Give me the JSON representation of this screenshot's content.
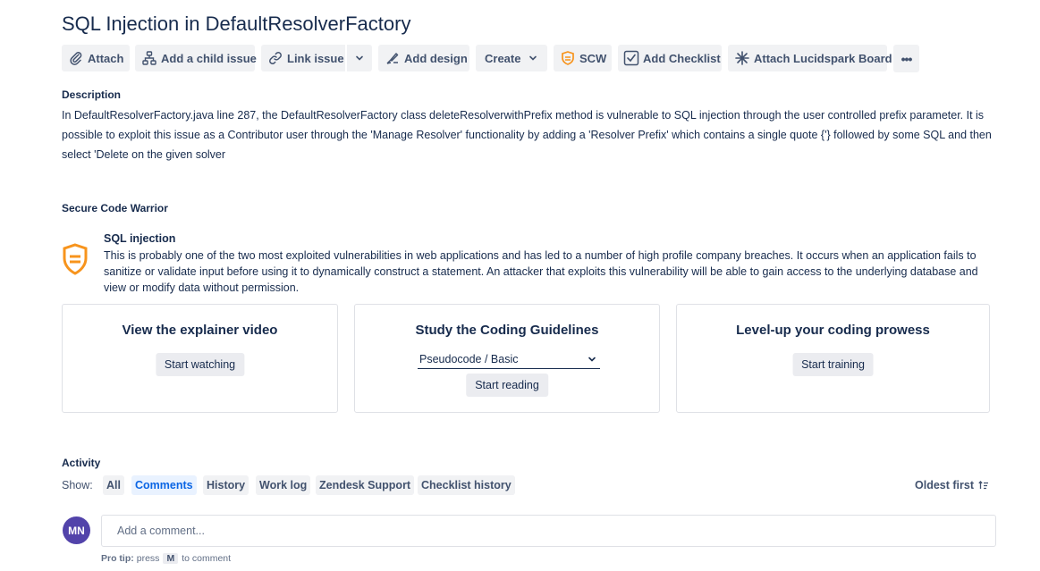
{
  "issue": {
    "title": "SQL Injection in DefaultResolverFactory"
  },
  "toolbar": {
    "attach": "Attach",
    "add_child": "Add a child issue",
    "link_issue": "Link issue",
    "add_design": "Add design",
    "create": "Create",
    "scw": "SCW",
    "add_checklist": "Add Checklist",
    "lucidspark": "Attach Lucidspark Board",
    "more": "•••"
  },
  "description": {
    "label": "Description",
    "text": "In DefaultResolverFactory.java line 287, the DefaultResolverFactory class deleteResolverwithPrefix method is vulnerable to SQL injection through the user controlled prefix parameter. It is possible to exploit this issue as a Contributor user through the 'Manage Resolver' functionality by adding a 'Resolver Prefix' which contains a single quote {'} followed by some SQL and then select 'Delete on the given solver"
  },
  "scw_panel": {
    "label": "Secure Code Warrior",
    "vuln_title": "SQL injection",
    "vuln_text": "This is probably one of the two most exploited vulnerabilities in web applications and has led to a number of high profile company breaches. It occurs when an application fails to sanitize or validate input before using it to dynamically construct a statement. An attacker that exploits this vulnerability will be able to gain access to the underlying database and view or modify data without permission.",
    "accent": "#f7941d",
    "cards": [
      {
        "title": "View the explainer video",
        "button": "Start watching"
      },
      {
        "title": "Study the Coding Guidelines",
        "select_value": "Pseudocode / Basic",
        "button": "Start reading"
      },
      {
        "title": "Level-up your coding prowess",
        "button": "Start training"
      }
    ]
  },
  "activity": {
    "label": "Activity",
    "show_label": "Show:",
    "filters": [
      "All",
      "Comments",
      "History",
      "Work log",
      "Zendesk Support",
      "Checklist history"
    ],
    "active_filter": "Comments",
    "sort": "Oldest first"
  },
  "comment": {
    "avatar_initials": "MN",
    "avatar_color": "#5243aa",
    "placeholder": "Add a comment...",
    "protip_label": "Pro tip:",
    "protip_pre": "press",
    "protip_key": "M",
    "protip_post": "to comment"
  }
}
